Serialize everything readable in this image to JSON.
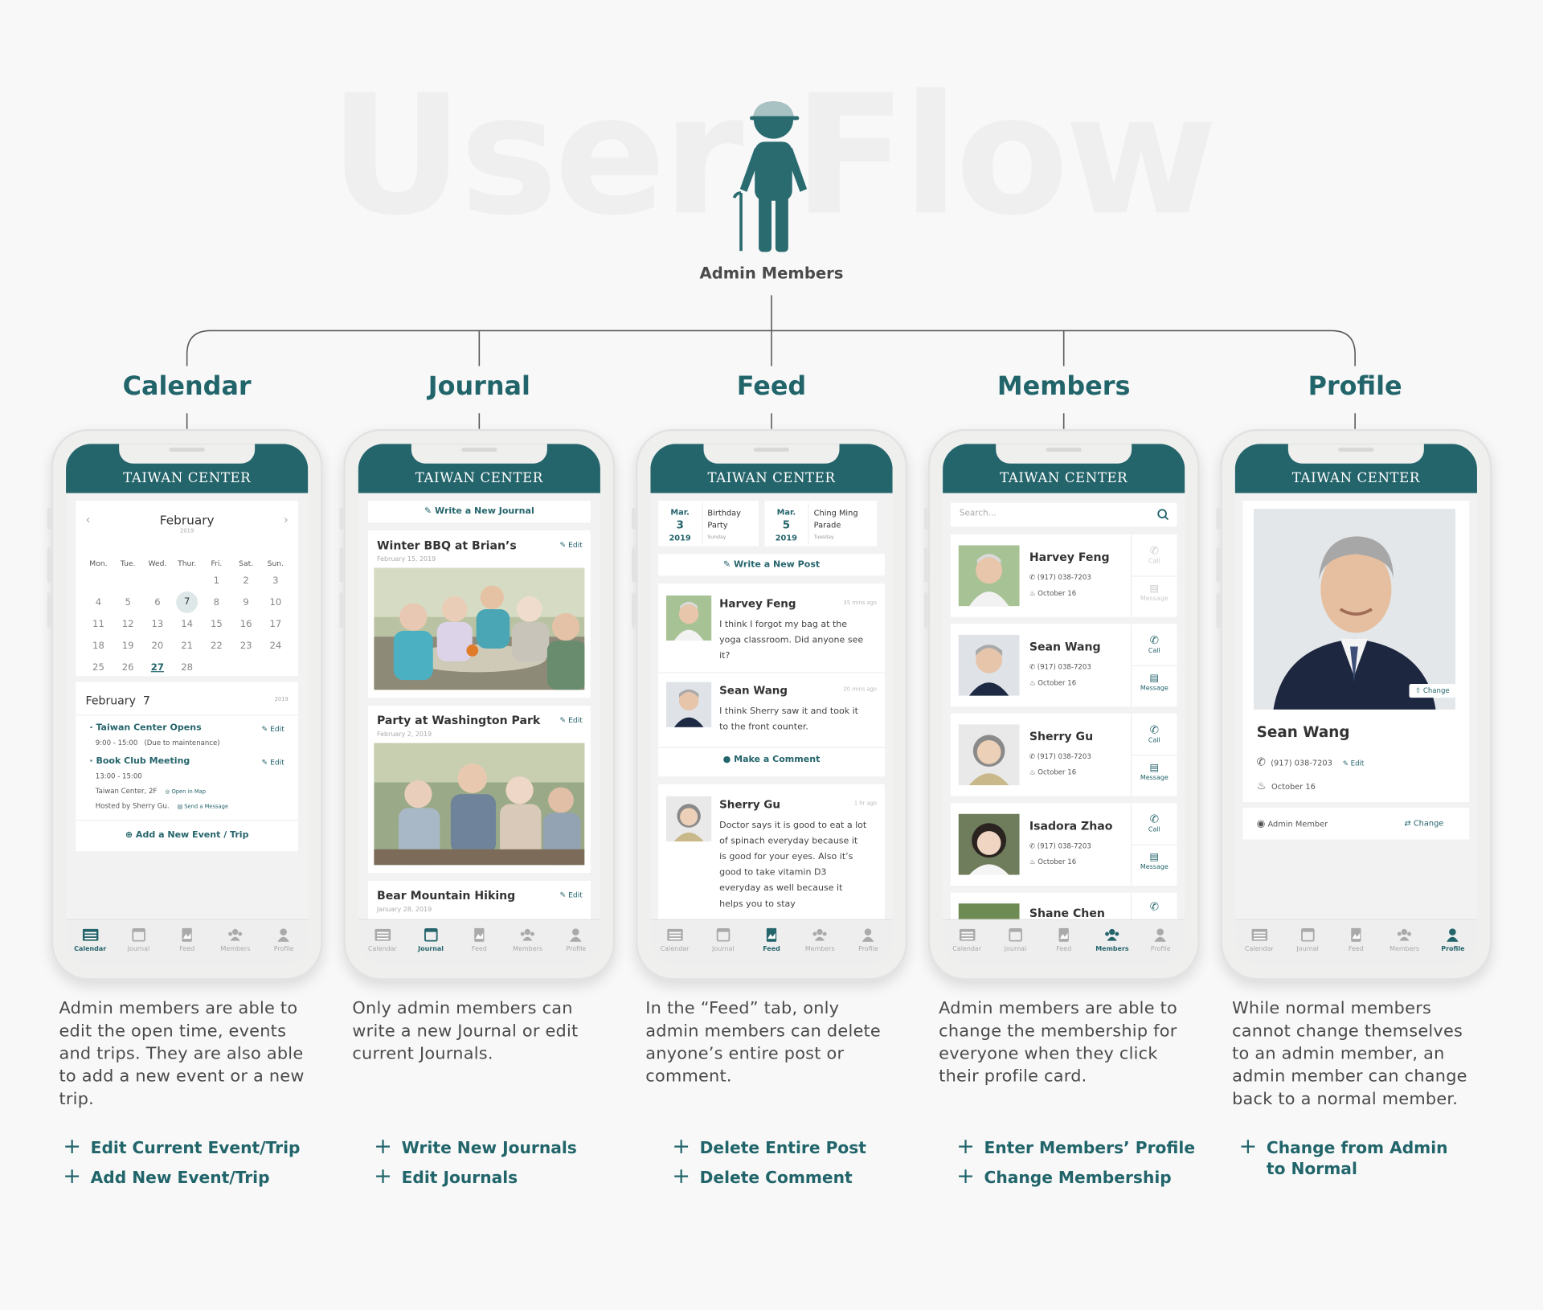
{
  "hero": {
    "title": "User Flow",
    "label": "Admin Members"
  },
  "app_title": "TAIWAN CENTER",
  "tabs": [
    "Calendar",
    "Journal",
    "Feed",
    "Members",
    "Profile"
  ],
  "columns": [
    {
      "title": "Calendar",
      "desc": "Admin members are able to edit the open time, events and trips. They are also able to add a new event or a new trip.",
      "actions": [
        "Edit Current Event/Trip",
        "Add New Event/Trip"
      ]
    },
    {
      "title": "Journal",
      "desc": "Only admin members can write a new Journal or edit current Journals.",
      "actions": [
        "Write New Journals",
        "Edit Journals"
      ]
    },
    {
      "title": "Feed",
      "desc": "In the “Feed” tab, only admin members can delete anyone’s entire post or comment.",
      "actions": [
        "Delete Entire Post",
        "Delete Comment"
      ]
    },
    {
      "title": "Members",
      "desc": "Admin members are able to change the membership for everyone when they click their profile card.",
      "actions": [
        "Enter Members’ Profile",
        "Change Membership"
      ]
    },
    {
      "title": "Profile",
      "desc": "While normal members cannot change themselves to an admin member, an admin member can change back to a normal member.",
      "actions": [
        "Change from Admin to Normal"
      ]
    }
  ],
  "calendar": {
    "month": "February",
    "year": "2019",
    "weekdays": [
      "Mon.",
      "Tue.",
      "Wed.",
      "Thur.",
      "Fri.",
      "Sat.",
      "Sun."
    ],
    "weeks": [
      [
        "",
        "",
        "",
        "",
        "1",
        "2",
        "3"
      ],
      [
        "4",
        "5",
        "6",
        "7",
        "8",
        "9",
        "10"
      ],
      [
        "11",
        "12",
        "13",
        "14",
        "15",
        "16",
        "17"
      ],
      [
        "18",
        "19",
        "20",
        "21",
        "22",
        "23",
        "24"
      ],
      [
        "25",
        "26",
        "27",
        "28",
        "",
        "",
        ""
      ]
    ],
    "selected": "7",
    "today": "27",
    "day_title": "February  7",
    "day_year": "2019",
    "events": [
      {
        "title": "Taiwan Center Opens",
        "time": "9:00 - 15:00   (Due to maintenance)",
        "edit": "Edit"
      },
      {
        "title": "Book Club Meeting",
        "time": "13:00 - 15:00",
        "edit": "Edit",
        "place": "Taiwan Center, 2F",
        "map": "Open in Map",
        "host": "Hosted by Sherry Gu.",
        "msg": "Send a Message"
      }
    ],
    "add_event": "Add a New Event / Trip"
  },
  "journal": {
    "write": "Write a New Journal",
    "entries": [
      {
        "title": "Winter BBQ at Brian’s",
        "date": "February 15, 2019",
        "edit": "Edit"
      },
      {
        "title": "Party at Washington Park",
        "date": "February 2, 2019",
        "edit": "Edit"
      },
      {
        "title": "Bear Mountain Hiking",
        "date": "January 28, 2019",
        "edit": "Edit"
      }
    ]
  },
  "feed": {
    "events": [
      {
        "mon": "Mar.",
        "day": "3",
        "year": "2019",
        "title": "Birthday Party",
        "weekday": "Sunday"
      },
      {
        "mon": "Mar.",
        "day": "5",
        "year": "2019",
        "title": "Ching Ming Parade",
        "weekday": "Tuesday"
      }
    ],
    "write": "Write a New Post",
    "posts": [
      {
        "name": "Harvey Feng",
        "time": "35 mins ago",
        "text": "I think I forgot my bag at the yoga classroom. Did anyone see it?"
      },
      {
        "name": "Sean Wang",
        "time": "20 mins ago",
        "text": "I think Sherry saw it and took it to the front counter."
      },
      {
        "name": "Sherry Gu",
        "time": "1 hr ago",
        "text": "Doctor says it is good to eat a lot of spinach everyday because it is good for your eyes. Also it’s good to take vitamin D3 everyday as well because it helps you to stay"
      }
    ],
    "comment": "Make a Comment"
  },
  "members": {
    "search": "Search...",
    "call": "Call",
    "message": "Message",
    "list": [
      {
        "name": "Harvey Feng",
        "phone": "(917) 038-7203",
        "bday": "October 16"
      },
      {
        "name": "Sean Wang",
        "phone": "(917) 038-7203",
        "bday": "October 16"
      },
      {
        "name": "Sherry Gu",
        "phone": "(917) 038-7203",
        "bday": "October 16"
      },
      {
        "name": "Isadora Zhao",
        "phone": "(917) 038-7203",
        "bday": "October 16"
      },
      {
        "name": "Shane Chen",
        "phone": "",
        "bday": ""
      }
    ]
  },
  "profile": {
    "name": "Sean Wang",
    "phone": "(917) 038-7203",
    "edit": "Edit",
    "bday": "October 16",
    "photo_change": "Change",
    "role": "Admin Member",
    "role_change": "Change"
  },
  "colors": {
    "primary": "#24646b",
    "title": "#21656b",
    "background": "#f8f8f8"
  }
}
